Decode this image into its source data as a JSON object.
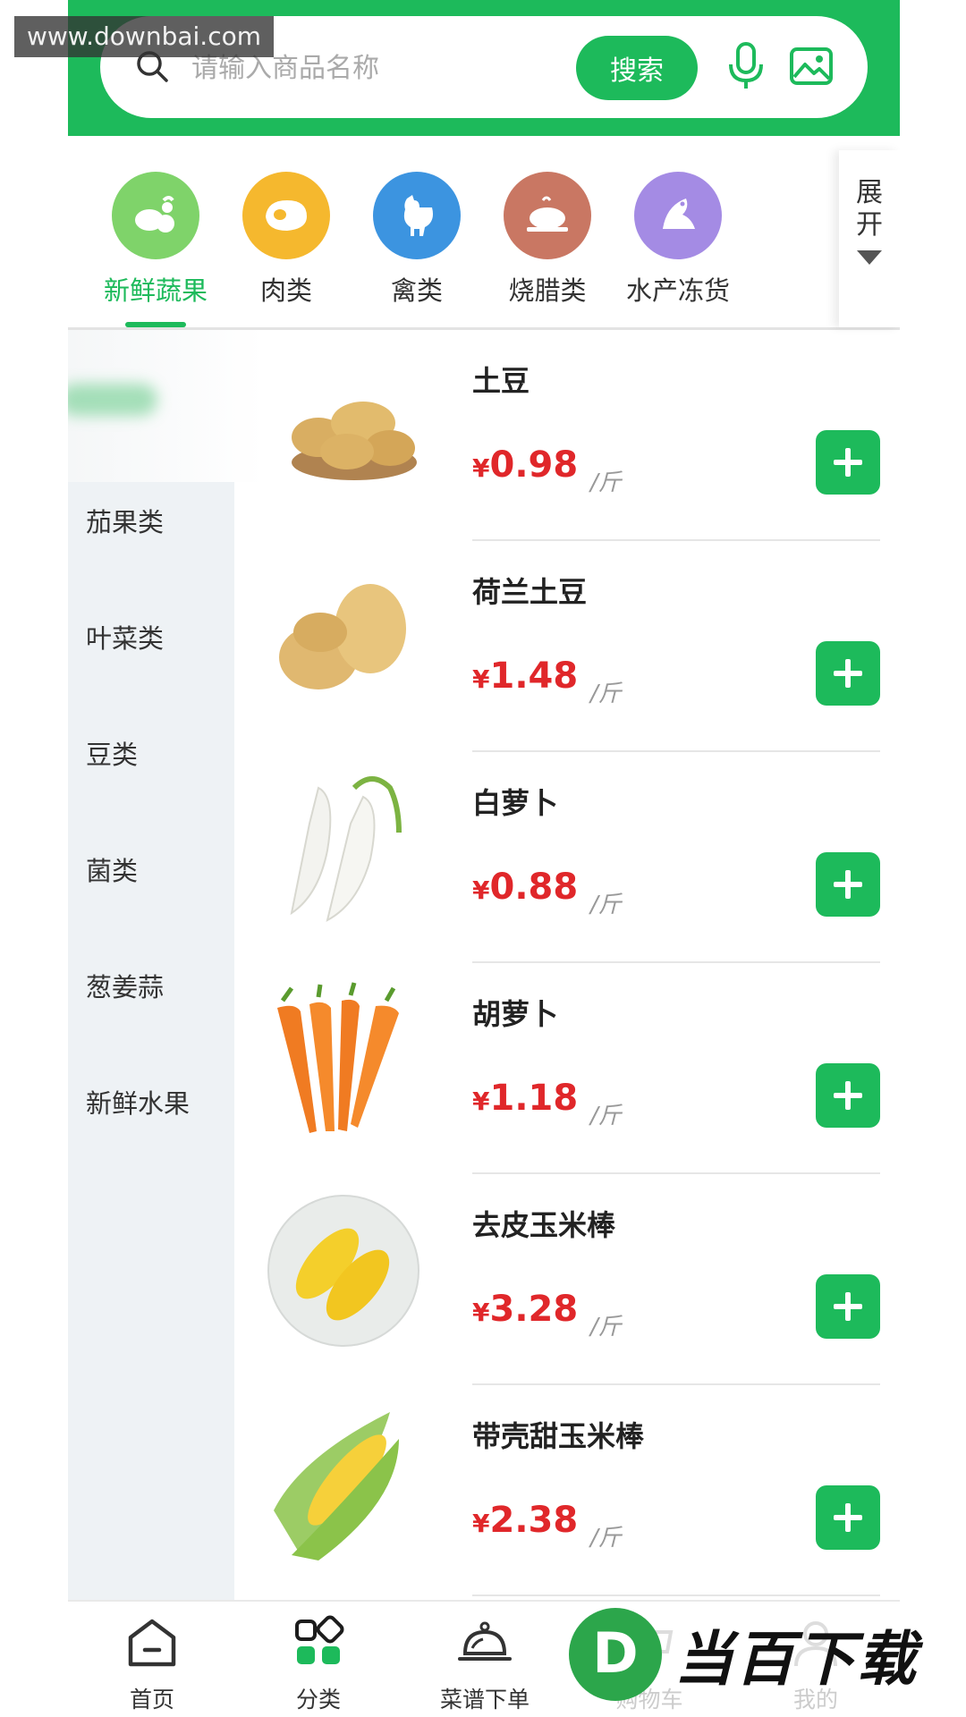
{
  "watermark": {
    "url": "www.downbai.com",
    "brand": "当百下载",
    "brand_logo_letter": "D"
  },
  "search": {
    "placeholder": "请输入商品名称",
    "button_label": "搜索"
  },
  "categories": {
    "items": [
      {
        "label": "新鲜蔬果",
        "icon": "vegetables-icon",
        "color": "#7fd36a",
        "active": true
      },
      {
        "label": "肉类",
        "icon": "meat-icon",
        "color": "#f5b82e",
        "active": false
      },
      {
        "label": "禽类",
        "icon": "chicken-icon",
        "color": "#3c94e0",
        "active": false
      },
      {
        "label": "烧腊类",
        "icon": "roast-icon",
        "color": "#c97763",
        "active": false
      },
      {
        "label": "水产冻货",
        "icon": "fish-icon",
        "color": "#a48be4",
        "active": false
      }
    ],
    "expand_label": "展开"
  },
  "sidebar": {
    "items": [
      {
        "label": "茄果类"
      },
      {
        "label": "叶菜类"
      },
      {
        "label": "豆类"
      },
      {
        "label": "菌类"
      },
      {
        "label": "葱姜蒜"
      },
      {
        "label": "新鲜水果"
      }
    ]
  },
  "products": [
    {
      "name": "土豆",
      "currency": "¥",
      "price": "0.98",
      "unit": "/斤",
      "image": "potato-basket"
    },
    {
      "name": "荷兰土豆",
      "currency": "¥",
      "price": "1.48",
      "unit": "/斤",
      "image": "potato"
    },
    {
      "name": "白萝卜",
      "currency": "¥",
      "price": "0.88",
      "unit": "/斤",
      "image": "white-radish"
    },
    {
      "name": "胡萝卜",
      "currency": "¥",
      "price": "1.18",
      "unit": "/斤",
      "image": "carrot"
    },
    {
      "name": "去皮玉米棒",
      "currency": "¥",
      "price": "3.28",
      "unit": "/斤",
      "image": "corn-plate"
    },
    {
      "name": "带壳甜玉米棒",
      "currency": "¥",
      "price": "2.38",
      "unit": "/斤",
      "image": "corn-husk"
    }
  ],
  "bottom_nav": {
    "items": [
      {
        "label": "首页",
        "icon": "home-icon"
      },
      {
        "label": "分类",
        "icon": "category-icon"
      },
      {
        "label": "菜谱下单",
        "icon": "cloche-icon"
      },
      {
        "label": "购物车",
        "icon": "cart-icon"
      },
      {
        "label": "我的",
        "icon": "profile-icon"
      }
    ]
  },
  "colors": {
    "accent": "#1dba5b",
    "price": "#e0272a",
    "sidebar_bg": "#eef2f5"
  }
}
